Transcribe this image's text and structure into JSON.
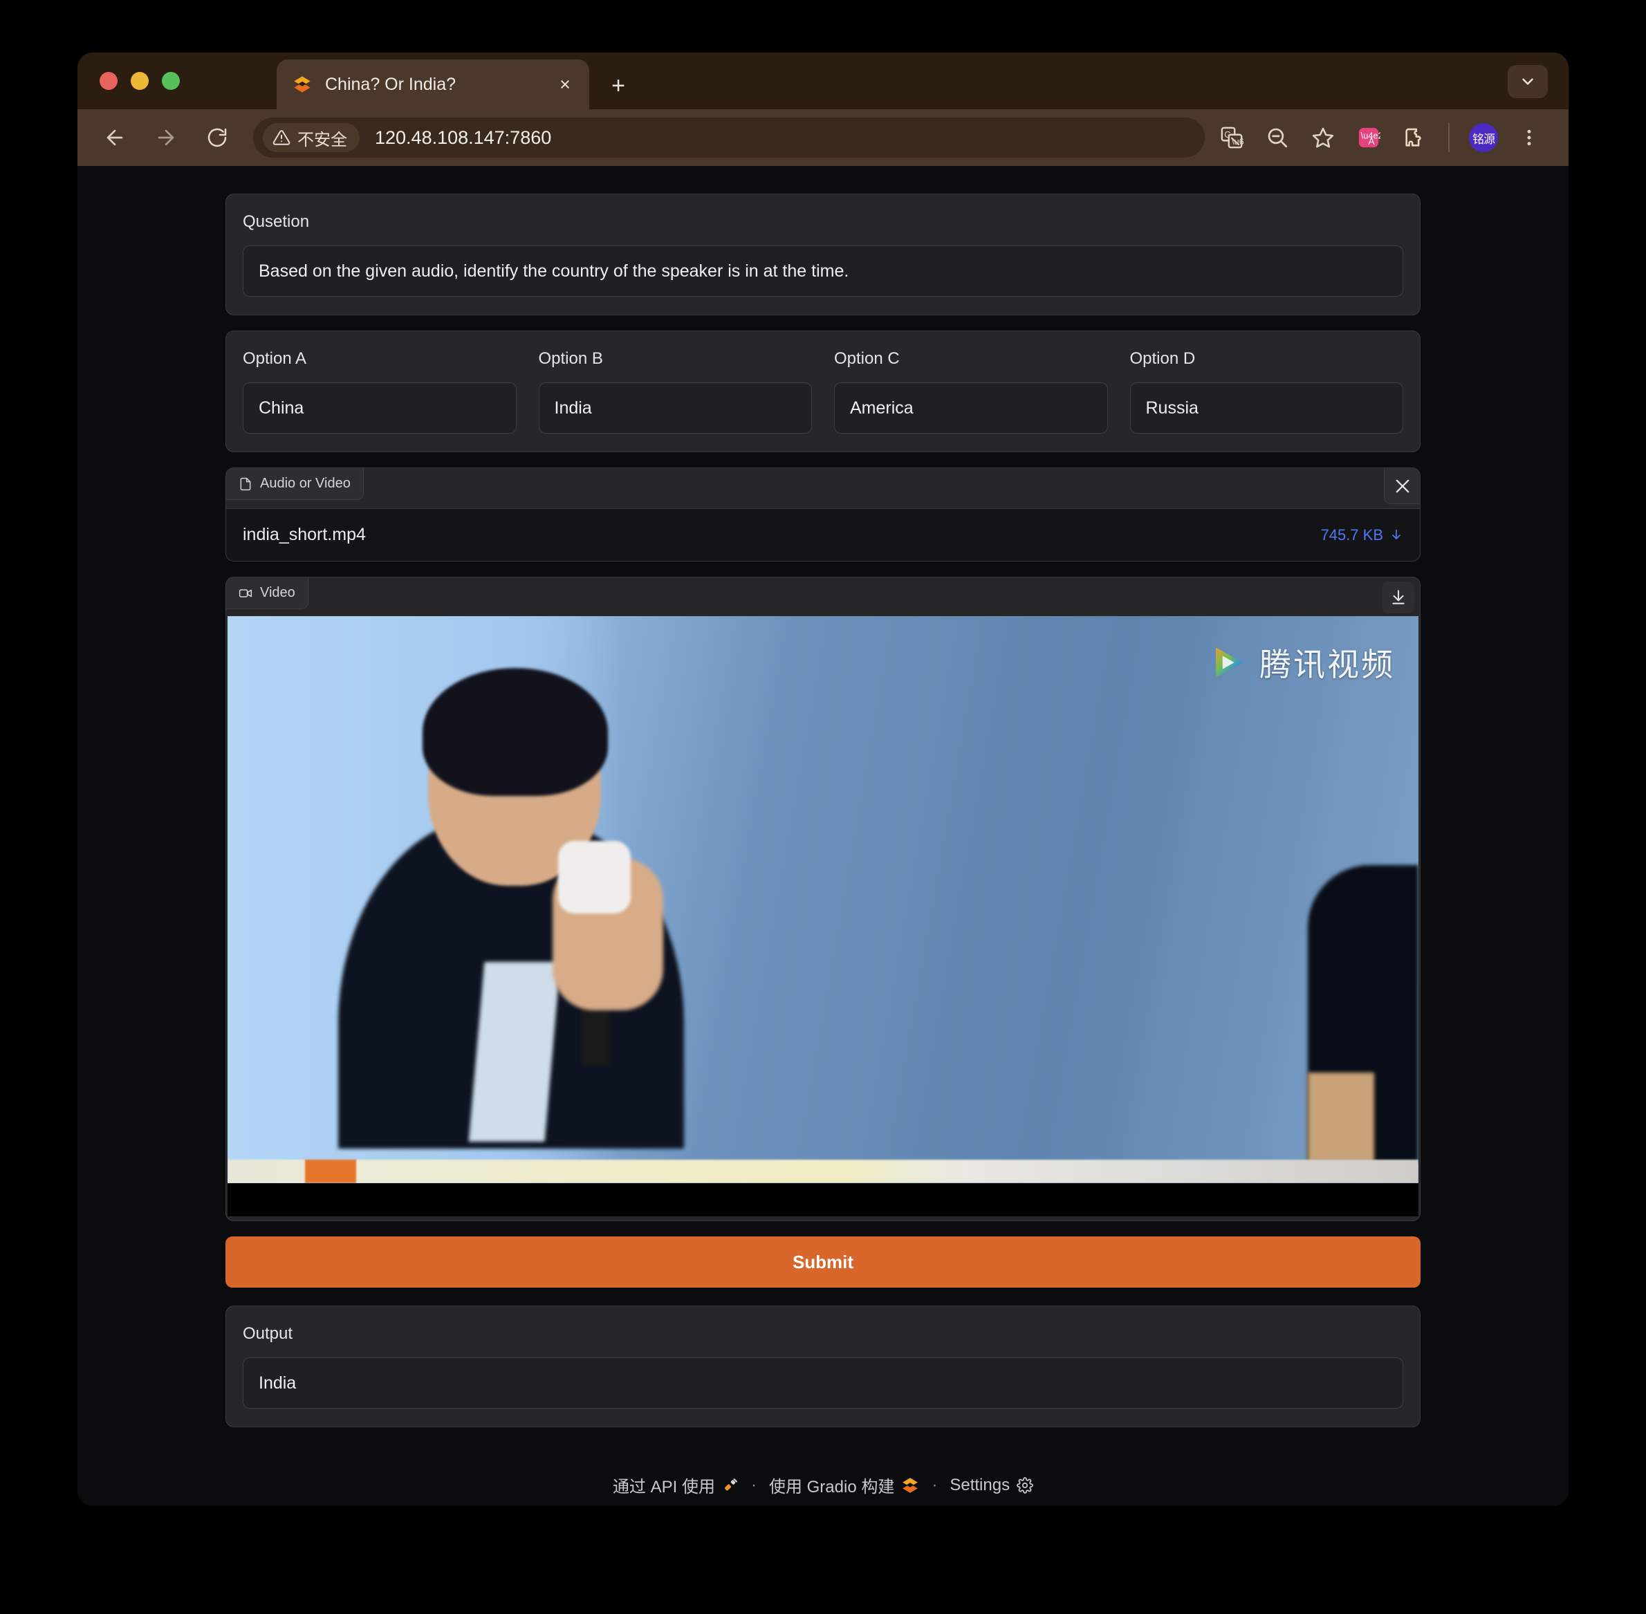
{
  "browser": {
    "window_controls": [
      "close",
      "minimize",
      "maximize"
    ],
    "tab": {
      "title": "China? Or India?",
      "favicon": "gradio-logo-icon",
      "close_label": "×"
    },
    "new_tab_label": "+",
    "toolbar": {
      "back_icon": "back-arrow-icon",
      "forward_icon": "forward-arrow-icon",
      "reload_icon": "reload-icon",
      "security_label": "不安全",
      "url": "120.48.108.147:7860",
      "actions": [
        "google-translate-icon",
        "zoom-out-icon",
        "bookmark-star-icon",
        "translate-extension-icon",
        "extensions-puzzle-icon"
      ],
      "profile_initials": "铭源",
      "menu_icon": "three-dot-menu-icon"
    }
  },
  "question": {
    "label": "Qusetion",
    "text": "Based on the given audio, identify the country of the speaker is in at the time."
  },
  "options": [
    {
      "label": "Option A",
      "value": "China"
    },
    {
      "label": "Option B",
      "value": "India"
    },
    {
      "label": "Option C",
      "value": "America"
    },
    {
      "label": "Option D",
      "value": "Russia"
    }
  ],
  "file_upload": {
    "tag_label": "Audio or Video",
    "tag_icon": "file-icon",
    "clear_icon": "close-icon",
    "file_name": "india_short.mp4",
    "file_size": "745.7 KB",
    "download_icon": "download-arrow-icon"
  },
  "video": {
    "tag_label": "Video",
    "tag_icon": "video-camera-icon",
    "download_icon": "download-icon",
    "watermark_text": "腾讯视频",
    "watermark_logo": "tencent-video-play-icon"
  },
  "submit": {
    "label": "Submit"
  },
  "output": {
    "label": "Output",
    "value": "India"
  },
  "footer": {
    "api_label": "通过 API 使用",
    "api_icon": "plug-icon",
    "separator": "·",
    "built_with_label": "使用 Gradio 构建",
    "built_with_icon": "gradio-logo-icon",
    "settings_label": "Settings",
    "settings_icon": "gear-icon"
  },
  "colors": {
    "accent_orange": "#d9672c",
    "link_blue": "#4d79f6",
    "panel_bg": "#27272a",
    "page_bg": "#0b0c0e",
    "chrome_titlebar": "#2b1d10",
    "chrome_toolbar": "#4a382a",
    "profile_badge": "#4b2ac4"
  }
}
